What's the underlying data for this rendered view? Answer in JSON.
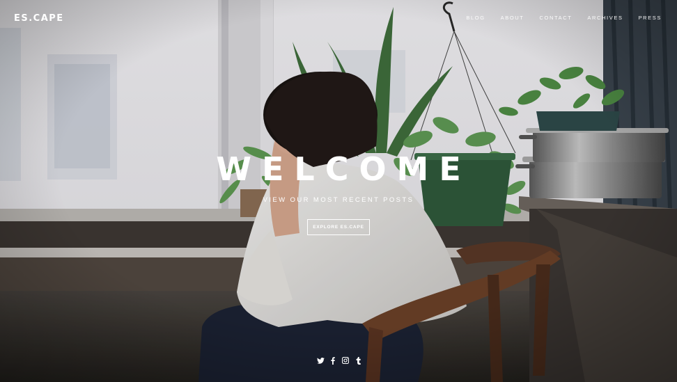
{
  "brand": {
    "logo": "ES.CAPE"
  },
  "nav": {
    "items": [
      {
        "label": "BLOG"
      },
      {
        "label": "ABOUT"
      },
      {
        "label": "CONTACT"
      },
      {
        "label": "ARCHIVES"
      },
      {
        "label": "PRESS"
      }
    ]
  },
  "hero": {
    "headline": "WELCOME",
    "subheadline": "VIEW OUR MOST RECENT POSTS",
    "cta_label": "EXPLORE ES.CAPE",
    "background": "photo of a person with short dark hair in a white shirt seated in a wooden chair by a bright window with potted plants, hanging plant and steel pots on a counter"
  },
  "social": {
    "icons": [
      "twitter-icon",
      "facebook-icon",
      "instagram-icon",
      "tumblr-icon"
    ]
  },
  "colors": {
    "text": "#ffffff",
    "window_light": "#ecebef",
    "plant_green": "#3d6a40",
    "wood_dark": "#3a2e28"
  }
}
